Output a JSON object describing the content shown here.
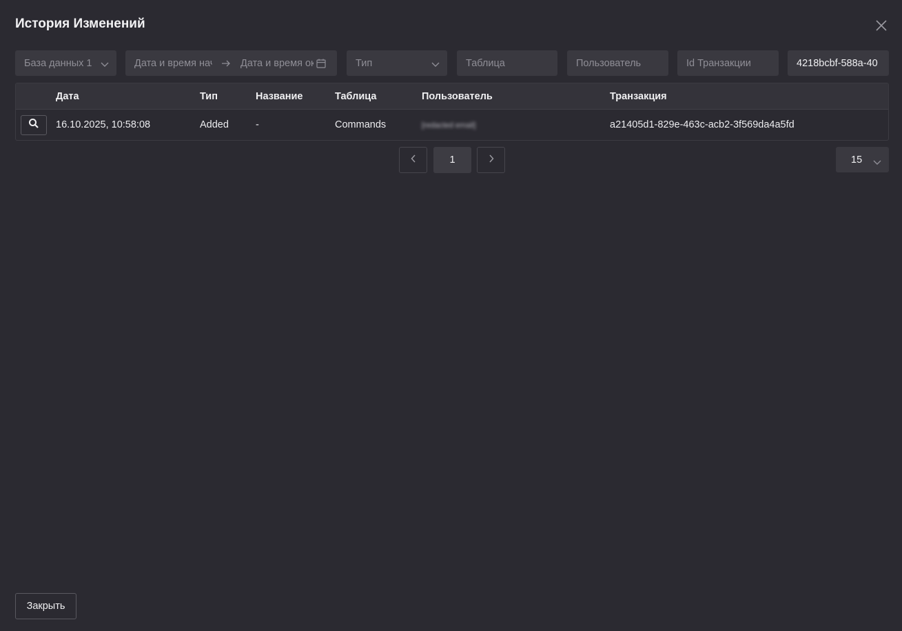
{
  "dialog": {
    "title": "История Изменений"
  },
  "filters": {
    "database": "База данных 1",
    "date_from_placeholder": "Дата и время начала",
    "date_to_placeholder": "Дата и время окончания",
    "type_placeholder": "Тип",
    "table_placeholder": "Таблица",
    "user_placeholder": "Пользователь",
    "transaction_id_placeholder": "Id Транзакции",
    "search_value": "4218bcbf-588a-40"
  },
  "table": {
    "columns": [
      "Дата",
      "Тип",
      "Название",
      "Таблица",
      "Пользователь",
      "Транзакция"
    ],
    "rows": [
      {
        "date": "16.10.2025, 10:58:08",
        "type": "Added",
        "name": "-",
        "table": "Commands",
        "user": "[redacted email]",
        "transaction": "a21405d1-829e-463c-acb2-3f569da4a5fd"
      }
    ]
  },
  "pagination": {
    "current_page": "1",
    "page_size": "15"
  },
  "footer": {
    "close_label": "Закрыть"
  },
  "icons": {
    "close": "close-icon",
    "chevron": "chevron-down-icon",
    "arrow": "arrow-right-icon",
    "calendar": "calendar-icon",
    "search": "search-icon",
    "prev": "chevron-left-icon",
    "next": "chevron-right-icon"
  },
  "colors": {
    "background": "#2b2a31",
    "input": "#3a3940",
    "header": "#34333a"
  }
}
